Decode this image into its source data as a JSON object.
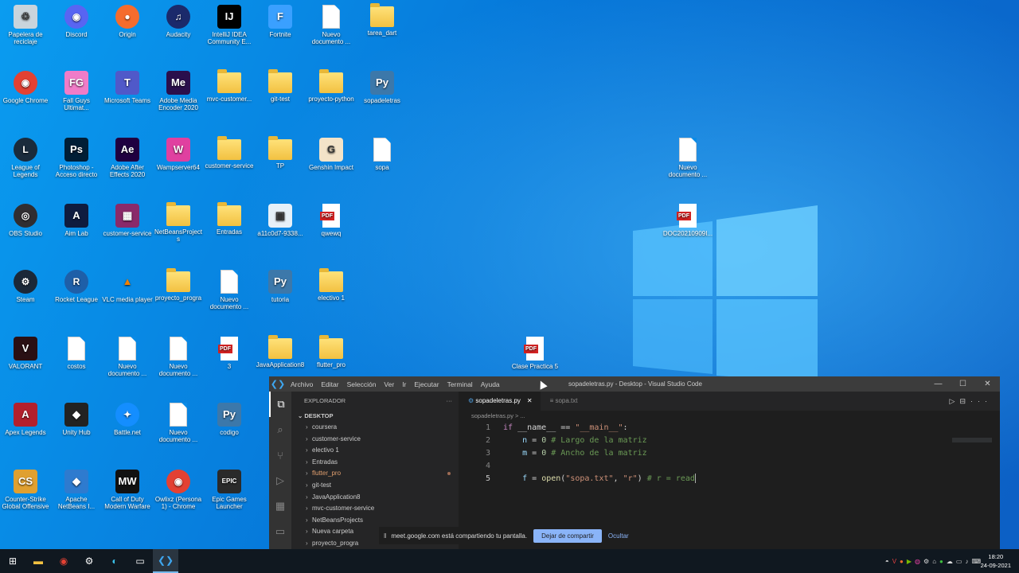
{
  "desktop": {
    "icons": [
      {
        "label": "Papelera de reciclaje",
        "kind": "bin"
      },
      {
        "label": "Discord",
        "kind": "discord"
      },
      {
        "label": "Origin",
        "kind": "origin"
      },
      {
        "label": "Audacity",
        "kind": "audacity"
      },
      {
        "label": "IntelliJ IDEA Community E...",
        "kind": "intellij"
      },
      {
        "label": "Fortnite",
        "kind": "fortnite"
      },
      {
        "label": "Nuevo documento ...",
        "kind": "doc"
      },
      {
        "label": "tarea_dart",
        "kind": "folder"
      },
      {
        "label": "Google Chrome",
        "kind": "chrome"
      },
      {
        "label": "Fall Guys Ultimat...",
        "kind": "fallguys"
      },
      {
        "label": "Microsoft Teams",
        "kind": "teams"
      },
      {
        "label": "Adobe Media Encoder 2020",
        "kind": "mediaencoder"
      },
      {
        "label": "mvc-customer...",
        "kind": "folder"
      },
      {
        "label": "git-test",
        "kind": "folder"
      },
      {
        "label": "proyecto-python",
        "kind": "folder"
      },
      {
        "label": "sopadeletras",
        "kind": "python"
      },
      {
        "label": "League of Legends",
        "kind": "lol"
      },
      {
        "label": "Photoshop - Acceso directo",
        "kind": "photoshop"
      },
      {
        "label": "Adobe After Effects 2020",
        "kind": "aftereffects"
      },
      {
        "label": "Wampserver64",
        "kind": "wamp"
      },
      {
        "label": "customer-service",
        "kind": "folder"
      },
      {
        "label": "TP",
        "kind": "folder"
      },
      {
        "label": "Genshin Impact",
        "kind": "genshin"
      },
      {
        "label": "sopa",
        "kind": "doc"
      },
      {
        "label": "OBS Studio",
        "kind": "obs"
      },
      {
        "label": "Aim Lab",
        "kind": "aimlab"
      },
      {
        "label": "customer-service",
        "kind": "winrar"
      },
      {
        "label": "NetBeansProjects",
        "kind": "folder"
      },
      {
        "label": "Entradas",
        "kind": "folder"
      },
      {
        "label": "a11c0d7-9338...",
        "kind": "image"
      },
      {
        "label": "qwewq",
        "kind": "pdf"
      },
      {
        "label": "Steam",
        "kind": "steam"
      },
      {
        "label": "Rocket League",
        "kind": "rocket"
      },
      {
        "label": "VLC media player",
        "kind": "vlc"
      },
      {
        "label": "proyecto_progra",
        "kind": "folder"
      },
      {
        "label": "Nuevo documento ...",
        "kind": "doc"
      },
      {
        "label": "tutoria",
        "kind": "python"
      },
      {
        "label": "electivo 1",
        "kind": "folder"
      },
      {
        "label": "VALORANT",
        "kind": "valorant"
      },
      {
        "label": "costos",
        "kind": "doc"
      },
      {
        "label": "Nuevo documento ...",
        "kind": "doc"
      },
      {
        "label": "Nuevo documento ...",
        "kind": "doc"
      },
      {
        "label": "3",
        "kind": "pdf"
      },
      {
        "label": "JavaApplication8",
        "kind": "folder"
      },
      {
        "label": "flutter_pro",
        "kind": "folder"
      },
      {
        "label": "Apex Legends",
        "kind": "apex"
      },
      {
        "label": "Unity Hub",
        "kind": "unity"
      },
      {
        "label": "Battle.net",
        "kind": "battlenet"
      },
      {
        "label": "Nuevo documento ...",
        "kind": "doc"
      },
      {
        "label": "codigo",
        "kind": "python"
      },
      {
        "label": "Counter-Strike Global Offensive",
        "kind": "csgo"
      },
      {
        "label": "Apache NetBeans I...",
        "kind": "netbeans"
      },
      {
        "label": "Call of Duty Modern Warfare",
        "kind": "cod"
      },
      {
        "label": "Owlixz (Persona 1) - Chrome",
        "kind": "chrome"
      },
      {
        "label": "Epic Games Launcher",
        "kind": "epic"
      },
      {
        "label": "Nuevo documento ...",
        "kind": "doc"
      },
      {
        "label": "DOC20210909I...",
        "kind": "pdf"
      },
      {
        "label": "Clase Practica 5",
        "kind": "pdf"
      }
    ]
  },
  "vscode": {
    "menu": [
      "Archivo",
      "Editar",
      "Selección",
      "Ver",
      "Ir",
      "Ejecutar",
      "Terminal",
      "Ayuda"
    ],
    "title": "sopadeletras.py - Desktop - Visual Studio Code",
    "explorer_header": "EXPLORADOR",
    "section": "DESKTOP",
    "tree": [
      {
        "label": "coursera",
        "modified": false
      },
      {
        "label": "customer-service",
        "modified": false
      },
      {
        "label": "electivo 1",
        "modified": false
      },
      {
        "label": "Entradas",
        "modified": false
      },
      {
        "label": "flutter_pro",
        "modified": true
      },
      {
        "label": "git-test",
        "modified": false
      },
      {
        "label": "JavaApplication8",
        "modified": false
      },
      {
        "label": "mvc-customer-service",
        "modified": false
      },
      {
        "label": "NetBeansProjects",
        "modified": false
      },
      {
        "label": "Nueva carpeta",
        "modified": false
      },
      {
        "label": "proyecto_progra",
        "modified": false
      }
    ],
    "tabs": [
      {
        "label": "sopadeletras.py",
        "active": true
      },
      {
        "label": "sopa.txt",
        "active": false
      }
    ],
    "breadcrumb": "sopadeletras.py > ...",
    "code": {
      "line_numbers": [
        "1",
        "2",
        "3",
        "4",
        "5"
      ],
      "l1": {
        "kw": "if",
        "a": " __name__ == ",
        "s": "\"__main__\"",
        "b": ":"
      },
      "l2": {
        "v": "n",
        "a": " = ",
        "n": "0",
        "c": " # Largo de la matriz"
      },
      "l3": {
        "v": "m",
        "a": " = ",
        "n": "0",
        "c": " # Ancho de la matriz"
      },
      "l5": {
        "v": "f",
        "a": " = ",
        "fn": "open",
        "p": "(",
        "s1": "\"sopa.txt\"",
        "comma": ", ",
        "s2": "\"r\"",
        "p2": ")",
        "c": " # r = read"
      }
    }
  },
  "share_banner": {
    "text": "meet.google.com está compartiendo tu pantalla.",
    "stop": "Dejar de compartir",
    "hide": "Ocultar"
  },
  "taskbar": {
    "time": "18:20",
    "date": "24-09-2021"
  }
}
